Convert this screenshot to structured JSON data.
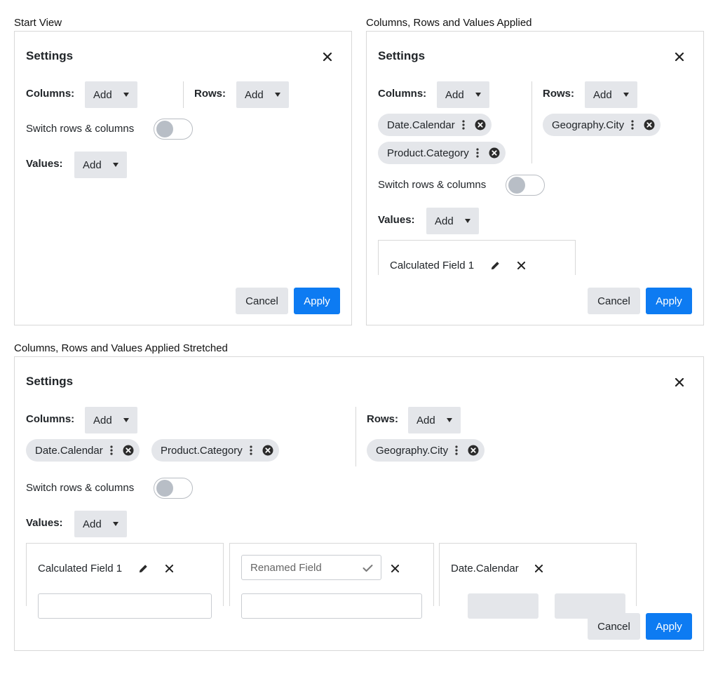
{
  "captions": {
    "start": "Start View",
    "applied": "Columns, Rows and Values Applied",
    "stretched": "Columns, Rows and Values Applied Stretched"
  },
  "settings": {
    "title": "Settings",
    "columns_label": "Columns:",
    "rows_label": "Rows:",
    "values_label": "Values:",
    "add_label": "Add",
    "switch_label": "Switch rows & columns",
    "cancel_label": "Cancel",
    "apply_label": "Apply"
  },
  "chips": {
    "date_calendar": "Date.Calendar",
    "product_category": "Product.Category",
    "geography_city": "Geography.City"
  },
  "values": {
    "calc_field": "Calculated Field 1",
    "rename_placeholder": "Renamed Field",
    "date_calendar": "Date.Calendar"
  },
  "colors": {
    "accent": "#0d7bf2",
    "chip_bg": "#e4e6ea",
    "border": "#d8d8d8"
  }
}
